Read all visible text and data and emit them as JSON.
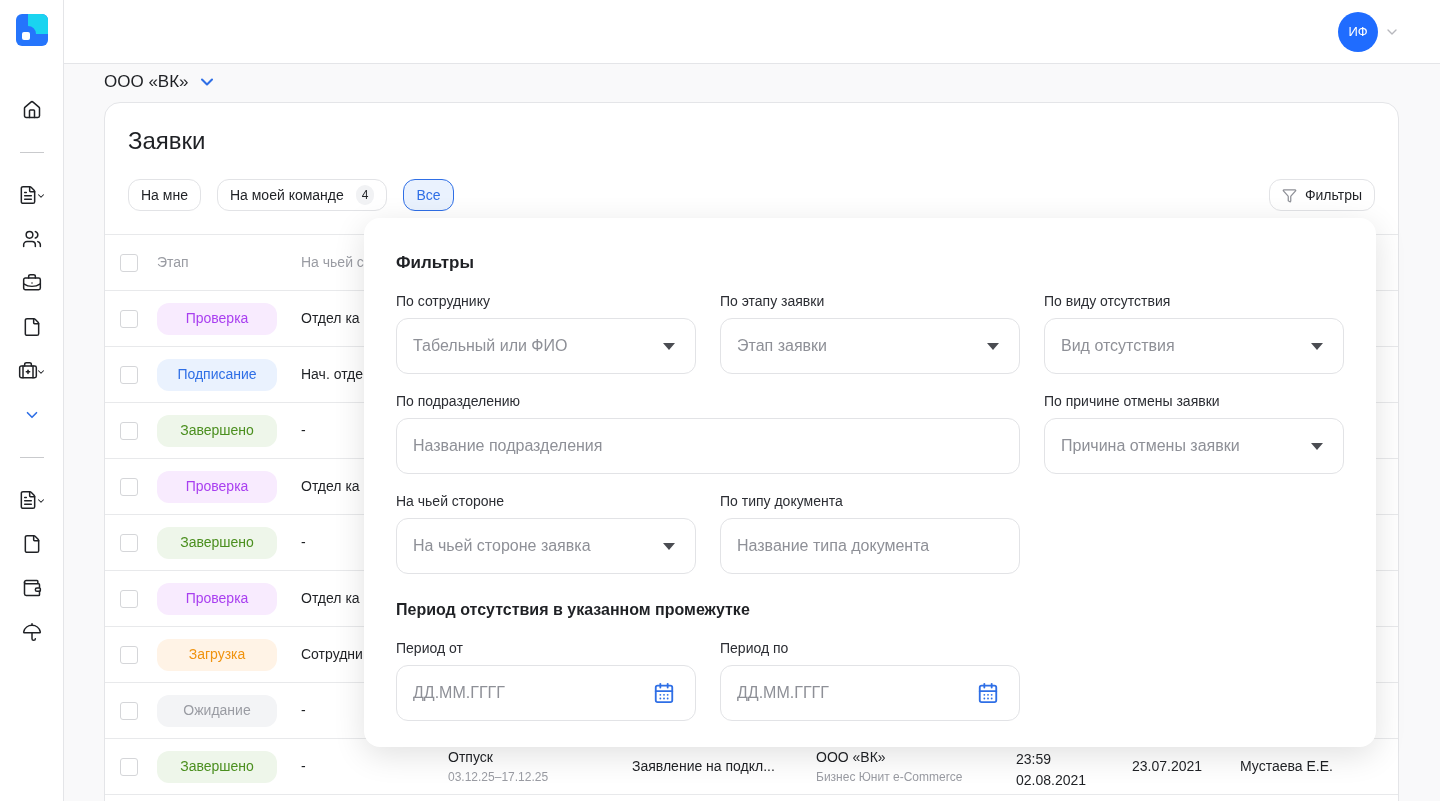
{
  "header": {
    "avatar": "ИФ"
  },
  "company": "ООО «ВК»",
  "card": {
    "title": "Заявки",
    "tabs": [
      {
        "label": "На мне",
        "selected": false
      },
      {
        "label": "На моей команде",
        "count": "4",
        "selected": false
      },
      {
        "label": "Все",
        "selected": true
      }
    ],
    "filters_button": "Фильтры"
  },
  "table": {
    "select_all_checked": false,
    "columns": [
      "Этап",
      "На чьей с"
    ],
    "rows": [
      {
        "checked": false,
        "stage": {
          "label": "Проверка",
          "kind": "review"
        },
        "side": "Отдел ка"
      },
      {
        "checked": false,
        "stage": {
          "label": "Подписание",
          "kind": "signing"
        },
        "side": "Нач. отде"
      },
      {
        "checked": false,
        "stage": {
          "label": "Завершено",
          "kind": "done"
        },
        "side": "-"
      },
      {
        "checked": false,
        "stage": {
          "label": "Проверка",
          "kind": "review"
        },
        "side": "Отдел ка"
      },
      {
        "checked": false,
        "stage": {
          "label": "Завершено",
          "kind": "done"
        },
        "side": "-"
      },
      {
        "checked": false,
        "stage": {
          "label": "Проверка",
          "kind": "review"
        },
        "side": "Отдел ка"
      },
      {
        "checked": false,
        "stage": {
          "label": "Загрузка",
          "kind": "upload"
        },
        "side": "Сотрудни"
      },
      {
        "checked": false,
        "stage": {
          "label": "Ожидание",
          "kind": "waiting"
        },
        "side": "-"
      },
      {
        "checked": false,
        "stage": {
          "label": "Завершено",
          "kind": "done"
        },
        "side": "-",
        "type": "Отпуск",
        "type_dates": "03.12.25–17.12.25",
        "document": "Заявление на подкл...",
        "org": "ООО «ВК»",
        "org_unit": "Бизнес Юнит e-Commerce",
        "time": "23:59",
        "date": "02.08.2021",
        "created": "23.07.2021",
        "author": "Мустаева Е.Е."
      }
    ]
  },
  "filter_panel": {
    "title": "Фильтры",
    "fields": [
      {
        "label": "По сотруднику",
        "placeholder": "Табельный или ФИО",
        "kind": "select",
        "wide": false
      },
      {
        "label": "По этапу заявки",
        "placeholder": "Этап заявки",
        "kind": "select",
        "wide": false
      },
      {
        "label": "По виду отсутствия",
        "placeholder": "Вид отсутствия",
        "kind": "select",
        "wide": false
      },
      {
        "label": "По подразделению",
        "placeholder": "Название подразделения",
        "kind": "text",
        "wide": true
      },
      {
        "label": "По причине отмены заявки",
        "placeholder": "Причина отмены заявки",
        "kind": "select",
        "wide": false
      },
      {
        "label": "На чьей стороне",
        "placeholder": "На чьей стороне заявка",
        "kind": "select",
        "wide": false
      },
      {
        "label": "По типу документа",
        "placeholder": "Название типа документа",
        "kind": "text",
        "wide": false
      }
    ],
    "period_title": "Период отсутствия в указанном промежутке",
    "period_fields": [
      {
        "label": "Период от",
        "placeholder": "ДД.ММ.ГГГГ",
        "kind": "date",
        "wide": false
      },
      {
        "label": "Период по",
        "placeholder": "ДД.ММ.ГГГГ",
        "kind": "date",
        "wide": false
      }
    ]
  }
}
